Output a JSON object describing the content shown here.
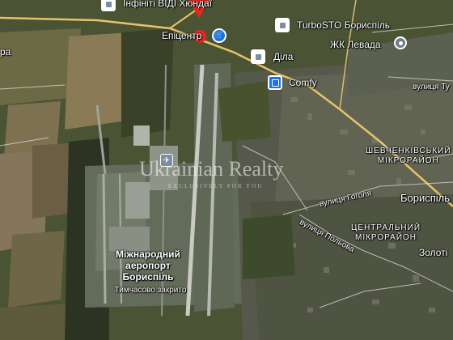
{
  "map": {
    "pois": {
      "infiniti": {
        "label": "Інфініті ВІДІ Хюндаї",
        "icon": "shop-icon"
      },
      "epicentr": {
        "label": "Епіцентр",
        "icon": "shopping-cart-icon"
      },
      "turbosto": {
        "label": "TurboSTO Бориспіль",
        "icon": "service-icon"
      },
      "dila": {
        "label": "Діла",
        "icon": "lab-icon"
      },
      "comfy": {
        "label": "Comfy",
        "icon": "shopping-bag-icon"
      },
      "levada": {
        "label": "ЖК Левада",
        "icon": "location-pin-icon"
      }
    },
    "streets": {
      "tupoleva": "вулиця Ту",
      "hoholia": "вулиця Гоголя",
      "polova": "вулиця Польова"
    },
    "districts": {
      "shevchenkivskyi": [
        "ШЕВЧЕНКІВСЬКИЙ",
        "МІКРОРАЙОН"
      ],
      "tsentralnyi": [
        "ЦЕНТРАЛЬНИЙ",
        "МІКРОРАЙОН"
      ]
    },
    "places": {
      "boryspil": "Бориспіль",
      "zolotonosha": "Золоті",
      "left_edge": "ра"
    },
    "airport": {
      "name_lines": [
        "Міжнародний",
        "аеропорт",
        "Бориспіль"
      ],
      "status": "Тимчасово закрито"
    },
    "watermark": {
      "title": "Ukrainian Realty",
      "tagline": "EXCLUSIVELY FOR YOU"
    },
    "marker_color": "#e8261f",
    "accent_blue": "#1a73e8"
  }
}
